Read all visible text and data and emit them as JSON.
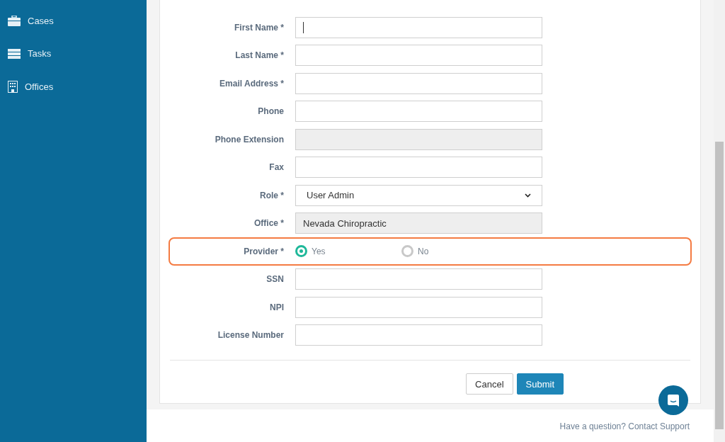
{
  "sidebar": {
    "items": [
      {
        "label": "Cases",
        "kind": "briefcase"
      },
      {
        "label": "Tasks",
        "kind": "tasks"
      },
      {
        "label": "Offices",
        "kind": "building"
      }
    ]
  },
  "form": {
    "fields": [
      {
        "label": "First Name *",
        "kind": "text",
        "focused": true
      },
      {
        "label": "Last Name *",
        "kind": "text",
        "focused": false
      },
      {
        "label": "Email Address *",
        "kind": "text",
        "focused": false
      },
      {
        "label": "Phone",
        "kind": "text",
        "focused": false
      },
      {
        "label": "Phone Extension",
        "kind": "disabled"
      },
      {
        "label": "Fax",
        "kind": "text",
        "focused": false
      },
      {
        "label": "Role *",
        "kind": "select",
        "value": "User Admin"
      },
      {
        "label": "Office *",
        "kind": "disabled",
        "value": "Nevada Chiropractic"
      },
      {
        "label": "Provider *",
        "kind": "radio",
        "highlighted": true,
        "options": [
          {
            "label": "Yes",
            "selected": true
          },
          {
            "label": "No",
            "selected": false
          }
        ]
      },
      {
        "label": "SSN",
        "kind": "text",
        "focused": false
      },
      {
        "label": "NPI",
        "kind": "text",
        "focused": false
      },
      {
        "label": "License Number",
        "kind": "text",
        "focused": false
      }
    ],
    "buttons": [
      {
        "label": "Cancel",
        "kind": "secondary"
      },
      {
        "label": "Submit",
        "kind": "primary"
      }
    ]
  },
  "footer": {
    "text": "Have a question? Contact Support"
  }
}
